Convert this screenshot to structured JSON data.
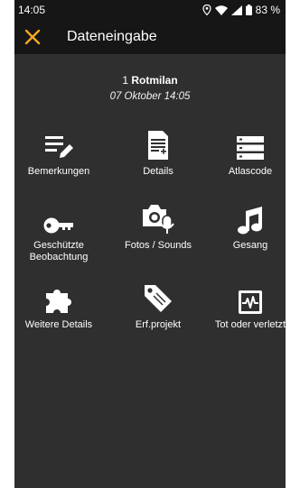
{
  "status_bar": {
    "time": "14:05",
    "battery": "83 %"
  },
  "app_bar": {
    "title": "Dateneingabe",
    "close_icon": "close-icon"
  },
  "observation": {
    "count": "1",
    "species": "Rotmilan",
    "datetime": "07 Oktober 14:05"
  },
  "colors": {
    "accent": "#f5a623",
    "background": "#2f2f2f",
    "bar": "#161616",
    "text": "#ffffff"
  },
  "menu": [
    {
      "label": "Bemerkungen",
      "icon": "notes-edit-icon"
    },
    {
      "label": "Details",
      "icon": "details-document-icon"
    },
    {
      "label": "Atlascode",
      "icon": "atlascode-list-icon"
    },
    {
      "label": "Geschützte\nBeobachtung",
      "icon": "key-icon"
    },
    {
      "label": "Fotos / Sounds",
      "icon": "camera-mic-icon"
    },
    {
      "label": "Gesang",
      "icon": "music-note-icon"
    },
    {
      "label": "Weitere Details",
      "icon": "puzzle-icon"
    },
    {
      "label": "Erf.projekt",
      "icon": "tag-icon"
    },
    {
      "label": "Tot oder verletzt",
      "icon": "heartbeat-icon"
    }
  ]
}
